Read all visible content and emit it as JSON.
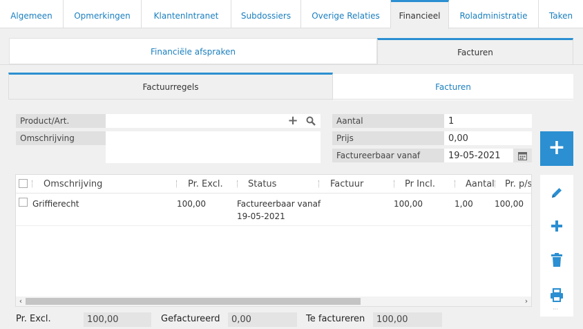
{
  "top_tabs": [
    {
      "label": "Algemeen",
      "active": false
    },
    {
      "label": "Opmerkingen",
      "active": false
    },
    {
      "label": "KlantenIntranet",
      "active": false
    },
    {
      "label": "Subdossiers",
      "active": false
    },
    {
      "label": "Overige Relaties",
      "active": false
    },
    {
      "label": "Financieel",
      "active": true
    },
    {
      "label": "Roladministratie",
      "active": false
    },
    {
      "label": "Taken",
      "active": false
    }
  ],
  "section_tabs": [
    {
      "label": "Financiële afspraken",
      "active": false
    },
    {
      "label": "Facturen",
      "active": true
    }
  ],
  "sub_tabs": [
    {
      "label": "Factuurregels",
      "active": true
    },
    {
      "label": "Facturen",
      "active": false
    }
  ],
  "form": {
    "product_label": "Product/Art.",
    "product_value": "",
    "description_label": "Omschrijving",
    "description_value": "",
    "quantity_label": "Aantal",
    "quantity_value": "1",
    "price_label": "Prijs",
    "price_value": "0,00",
    "billable_from_label": "Factureerbaar vanaf",
    "billable_from_value": "19-05-2021"
  },
  "table": {
    "columns": [
      "Omschrijving",
      "Pr. Excl.",
      "Status",
      "Factuur",
      "Pr Incl.",
      "Aantal",
      "Pr. p/s"
    ],
    "rows": [
      {
        "omschrijving": "Griffierecht",
        "pr_excl": "100,00",
        "status_line1": "Factureerbaar vanaf",
        "status_line2": "19-05-2021",
        "factuur": "",
        "pr_incl": "100,00",
        "aantal": "1,00",
        "pr_ps": "100,00"
      }
    ]
  },
  "totals": {
    "excl_label": "Pr. Excl.",
    "excl_value": "100,00",
    "invoiced_label": "Gefactureerd",
    "invoiced_value": "0,00",
    "to_invoice_label": "Te factureren",
    "to_invoice_value": "100,00"
  },
  "icons": {
    "add": "plus-icon",
    "search": "search-icon",
    "calendar": "calendar-icon",
    "edit": "pencil-icon",
    "delete": "trash-icon",
    "print": "printer-icon"
  },
  "colors": {
    "accent": "#2b8fd1",
    "link": "#1a7fbf"
  }
}
